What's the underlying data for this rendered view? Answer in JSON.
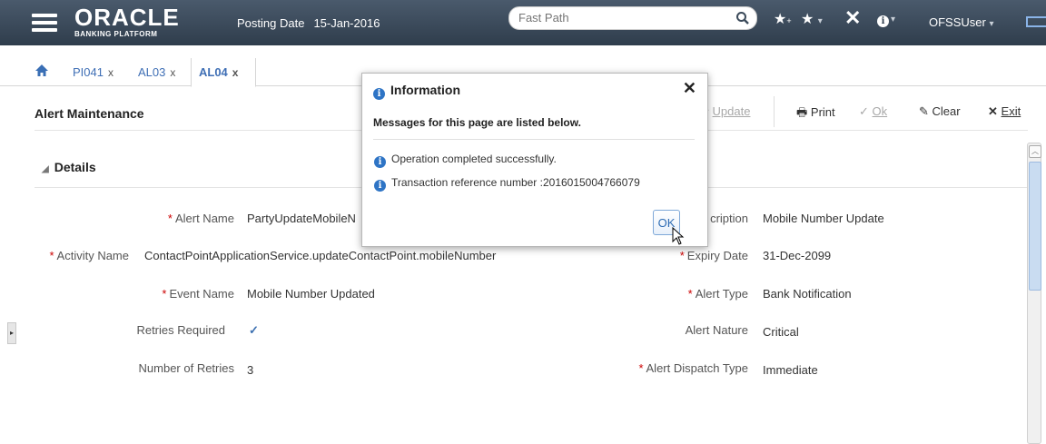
{
  "header": {
    "logo_main": "ORACLE",
    "logo_sub": "BANKING PLATFORM",
    "posting_label": "Posting Date",
    "posting_value": "15-Jan-2016",
    "fastpath_placeholder": "Fast Path",
    "user": "OFSSUser"
  },
  "tabs": [
    {
      "label": "PI041",
      "close": "x"
    },
    {
      "label": "AL03",
      "close": "x"
    },
    {
      "label": "AL04",
      "close": "x"
    }
  ],
  "page": {
    "title": "Alert Maintenance",
    "toolbar": {
      "update": "Update",
      "print": "Print",
      "ok": "Ok",
      "clear": "Clear",
      "exit": "Exit"
    },
    "section": "Details"
  },
  "fields": {
    "alert_name_label": "Alert Name",
    "alert_name_value": "PartyUpdateMobileN",
    "activity_name_label": "Activity Name",
    "activity_name_value": "ContactPointApplicationService.updateContactPoint.mobileNumber",
    "event_name_label": "Event Name",
    "event_name_value": "Mobile Number Updated",
    "retries_required_label": "Retries Required",
    "retries_required_value": "✓",
    "number_of_retries_label": "Number of Retries",
    "number_of_retries_value": "3",
    "description_label": "cription",
    "description_value": "Mobile Number Update",
    "expiry_date_label": "Expiry Date",
    "expiry_date_value": "31-Dec-2099",
    "alert_type_label": "Alert Type",
    "alert_type_value": "Bank Notification",
    "alert_nature_label": "Alert Nature",
    "alert_nature_value": "Critical",
    "dispatch_type_label": "Alert Dispatch Type",
    "dispatch_type_value": "Immediate",
    "required_mark": "*"
  },
  "dialog": {
    "title": "Information",
    "close": "✕",
    "intro": "Messages for this page are listed below.",
    "messages": [
      "Operation completed successfully.",
      "Transaction reference number :2016015004766079"
    ],
    "ok": "OK"
  },
  "colors": {
    "header_bg": "#3a4858",
    "link_blue": "#3f6fb5",
    "info_blue": "#2e74c5",
    "required_red": "#cc0000"
  }
}
